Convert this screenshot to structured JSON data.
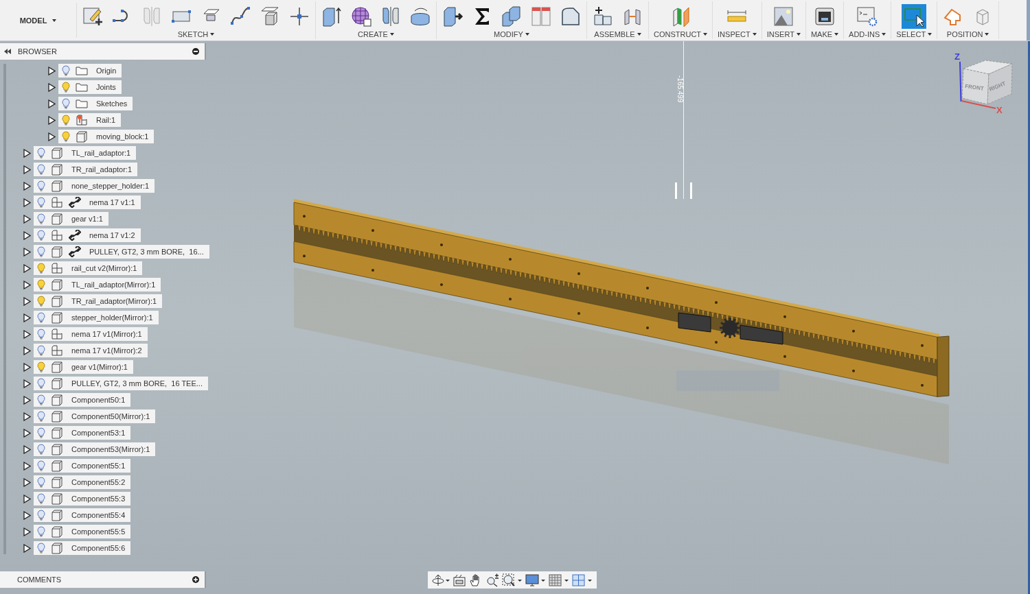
{
  "toolbar": {
    "workspace": "MODEL",
    "groups": [
      {
        "label": "SKETCH",
        "active": false
      },
      {
        "label": "CREATE",
        "active": false
      },
      {
        "label": "MODIFY",
        "active": false
      },
      {
        "label": "ASSEMBLE",
        "active": false
      },
      {
        "label": "CONSTRUCT",
        "active": false
      },
      {
        "label": "INSPECT",
        "active": false
      },
      {
        "label": "INSERT",
        "active": false
      },
      {
        "label": "MAKE",
        "active": false
      },
      {
        "label": "ADD-INS",
        "active": false
      },
      {
        "label": "SELECT",
        "active": true
      },
      {
        "label": "POSITION",
        "active": false
      }
    ]
  },
  "browser": {
    "title": "BROWSER",
    "tree": [
      {
        "children": [
          {
            "label": "Origin",
            "lit": false,
            "kind": "folder",
            "linked": false
          },
          {
            "label": "Joints",
            "lit": true,
            "kind": "folder",
            "linked": false
          },
          {
            "label": "Sketches",
            "lit": false,
            "kind": "folder",
            "linked": false
          },
          {
            "label": "Rail:1",
            "lit": true,
            "kind": "rail",
            "linked": false
          },
          {
            "label": "moving_block:1",
            "lit": true,
            "kind": "body",
            "linked": false
          }
        ]
      },
      {
        "label": "TL_rail_adaptor:1",
        "lit": false,
        "kind": "body",
        "linked": false
      },
      {
        "label": "TR_rail_adaptor:1",
        "lit": false,
        "kind": "body",
        "linked": false
      },
      {
        "label": "none_stepper_holder:1",
        "lit": false,
        "kind": "body",
        "linked": false
      },
      {
        "label": "nema 17 v1:1",
        "lit": false,
        "kind": "assembly",
        "linked": true
      },
      {
        "label": "gear v1:1",
        "lit": false,
        "kind": "body",
        "linked": false
      },
      {
        "label": "nema 17 v1:2",
        "lit": false,
        "kind": "assembly",
        "linked": true
      },
      {
        "label": "PULLEY, GT2, 3 mm BORE,  16...",
        "lit": false,
        "kind": "body",
        "linked": true
      },
      {
        "label": "rail_cut v2(Mirror):1",
        "lit": true,
        "kind": "assembly",
        "linked": false
      },
      {
        "label": "TL_rail_adaptor(Mirror):1",
        "lit": true,
        "kind": "body",
        "linked": false
      },
      {
        "label": "TR_rail_adaptor(Mirror):1",
        "lit": true,
        "kind": "body",
        "linked": false
      },
      {
        "label": "stepper_holder(Mirror):1",
        "lit": false,
        "kind": "body",
        "linked": false
      },
      {
        "label": "nema 17 v1(Mirror):1",
        "lit": false,
        "kind": "assembly",
        "linked": false
      },
      {
        "label": "nema 17 v1(Mirror):2",
        "lit": false,
        "kind": "assembly",
        "linked": false
      },
      {
        "label": "gear v1(Mirror):1",
        "lit": true,
        "kind": "body",
        "linked": false
      },
      {
        "label": "PULLEY, GT2, 3 mm BORE,  16 TEE...",
        "lit": false,
        "kind": "body",
        "linked": false
      },
      {
        "label": "Component50:1",
        "lit": false,
        "kind": "body",
        "linked": false
      },
      {
        "label": "Component50(Mirror):1",
        "lit": false,
        "kind": "body",
        "linked": false
      },
      {
        "label": "Component53:1",
        "lit": false,
        "kind": "body",
        "linked": false
      },
      {
        "label": "Component53(Mirror):1",
        "lit": false,
        "kind": "body",
        "linked": false
      },
      {
        "label": "Component55:1",
        "lit": false,
        "kind": "body",
        "linked": false
      },
      {
        "label": "Component55:2",
        "lit": false,
        "kind": "body",
        "linked": false
      },
      {
        "label": "Component55:3",
        "lit": false,
        "kind": "body",
        "linked": false
      },
      {
        "label": "Component55:4",
        "lit": false,
        "kind": "body",
        "linked": false
      },
      {
        "label": "Component55:5",
        "lit": false,
        "kind": "body",
        "linked": false
      },
      {
        "label": "Component55:6",
        "lit": false,
        "kind": "body",
        "linked": false
      }
    ]
  },
  "comments": {
    "title": "COMMENTS"
  },
  "viewport": {
    "dimension": "-165.499",
    "view_cube": {
      "faces": [
        "FRONT",
        "RIGHT"
      ],
      "axes": [
        "Z",
        "X"
      ]
    }
  }
}
